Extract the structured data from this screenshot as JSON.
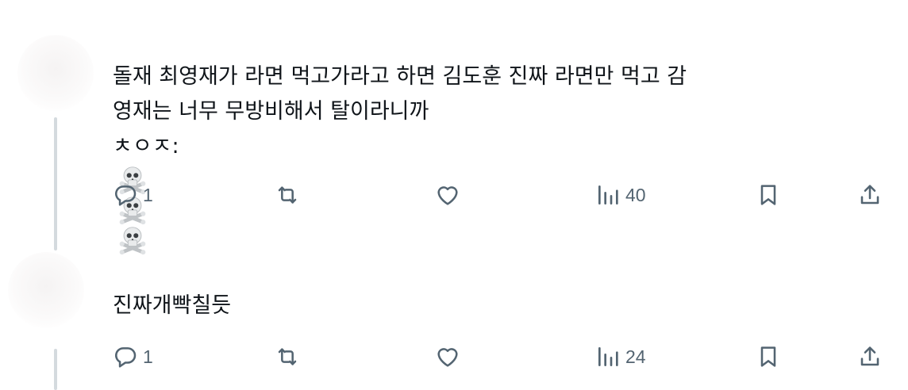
{
  "posts": [
    {
      "lines": [
        "돌재 최영재가 라면 먹고가라고 하면 김도훈 진짜 라면만 먹고 감",
        "영재는 너무 무방비해서 탈이라니까",
        "ㅊㅇㅈ:"
      ],
      "emojis": [
        "skull-crossbones-icon",
        "skull-crossbones-icon",
        "skull-crossbones-icon"
      ],
      "actions": {
        "replies": "1",
        "views": "40"
      }
    },
    {
      "lines": [
        "진짜개빡칠듯"
      ],
      "actions": {
        "replies": "1",
        "views": "24"
      }
    }
  ],
  "colors": {
    "text": "#0f1419",
    "icon": "#536471",
    "thread_line": "#d4dade"
  }
}
